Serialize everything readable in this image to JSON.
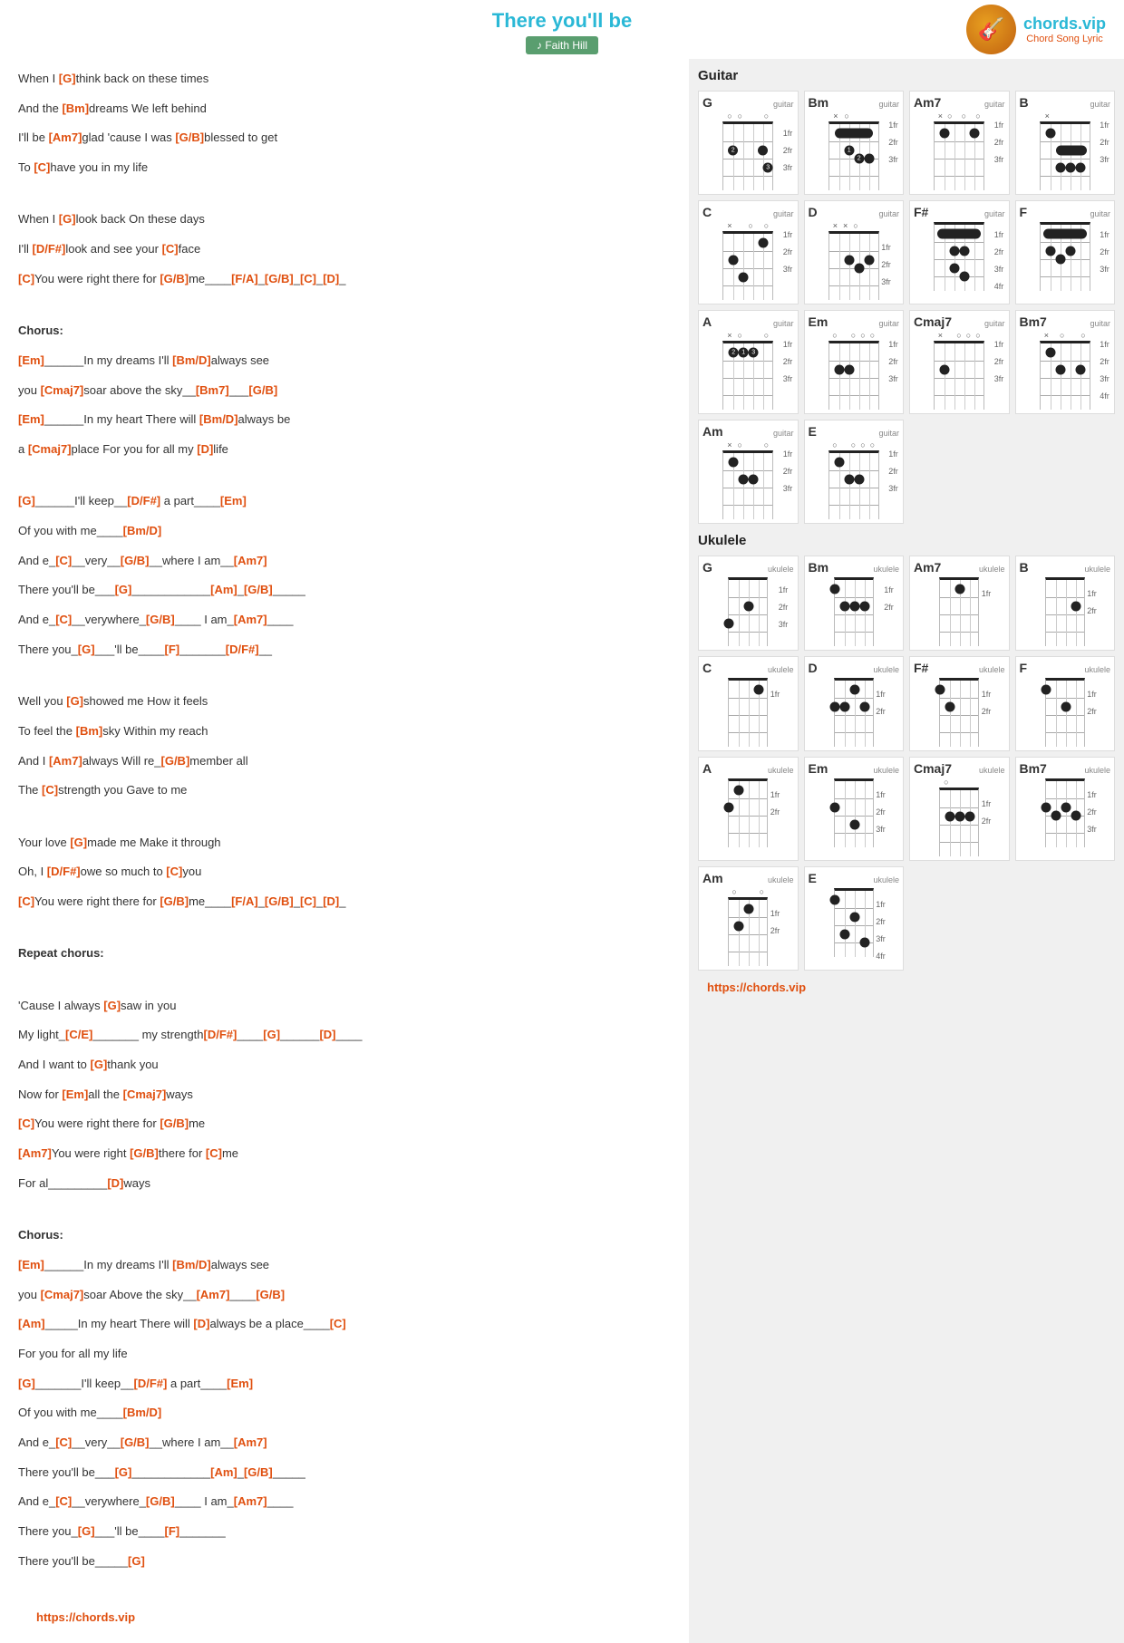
{
  "header": {
    "title": "There you'll be",
    "artist": "Faith Hill",
    "logo": {
      "brand": "chords.vip",
      "sub": "Chord Song Lyric",
      "icon": "🎸"
    }
  },
  "lyrics": [
    {
      "id": "v1l1",
      "text": "When I [G]think back on these times"
    },
    {
      "id": "v1l2",
      "text": "And the [Bm]dreams We left behind"
    },
    {
      "id": "v1l3",
      "text": "I'll be [Am7]glad 'cause I was [G/B]blessed to get"
    },
    {
      "id": "v1l4",
      "text": "To [C]have you in my life"
    },
    {
      "id": "v2l1",
      "text": "When I [G]look back On these days"
    },
    {
      "id": "v2l2",
      "text": "I'll [D/F#]look and see your [C]face"
    },
    {
      "id": "v2l3",
      "text": "[C]You were right there for [G/B]me____[F/A]_[G/B]_[C]_[D]_"
    },
    {
      "id": "ch1",
      "text": "Chorus:"
    },
    {
      "id": "c1l1",
      "text": "[Em]______In my dreams I'll [Bm/D]always see"
    },
    {
      "id": "c1l2",
      "text": "you [Cmaj7]soar above the sky__[Bm7]___[G/B]"
    },
    {
      "id": "c1l3",
      "text": "[Em]______In my heart There will [Bm/D]always be"
    },
    {
      "id": "c1l4",
      "text": "a [Cmaj7]place For you for all my [D]life"
    },
    {
      "id": "br1l1",
      "text": "[G]______I'll keep__[D/F#] a part____[Em]"
    },
    {
      "id": "br1l2",
      "text": "Of you with me____[Bm/D]"
    },
    {
      "id": "br1l3",
      "text": "And e_[C]__very__[G/B]__where I am__[Am7]"
    },
    {
      "id": "br1l4",
      "text": "There you'll be___[G]____________[Am]_[G/B]_____"
    },
    {
      "id": "br1l5",
      "text": "And e_[C]__verywhere_[G/B]____ I am_[Am7]____"
    },
    {
      "id": "br1l6",
      "text": "There you_[G]___'ll be____[F]_______[D/F#]__"
    },
    {
      "id": "v3l1",
      "text": "Well you [G]showed me How it feels"
    },
    {
      "id": "v3l2",
      "text": "To feel the [Bm]sky Within my reach"
    },
    {
      "id": "v3l3",
      "text": "And I [Am7]always Will re_[G/B]member all"
    },
    {
      "id": "v3l4",
      "text": "The [C]strength you Gave to me"
    },
    {
      "id": "v4l1",
      "text": "Your love [G]made me Make it through"
    },
    {
      "id": "v4l2",
      "text": "Oh, I [D/F#]owe so much to [C]you"
    },
    {
      "id": "v4l3",
      "text": "[C]You were right there for [G/B]me____[F/A]_[G/B]_[C]_[D]_"
    },
    {
      "id": "rep",
      "text": "Repeat chorus:"
    },
    {
      "id": "br2l1",
      "text": "'Cause I always [G]saw in you"
    },
    {
      "id": "br2l2",
      "text": "My light_[C/E]_______ my strength[D/F#]____[G]______[D]____"
    },
    {
      "id": "br2l3",
      "text": "And I want to [G]thank you"
    },
    {
      "id": "br2l4",
      "text": "Now for [Em]all the [Cmaj7]ways"
    },
    {
      "id": "br2l5",
      "text": "[C]You were right there for [G/B]me"
    },
    {
      "id": "br2l6",
      "text": "[Am7]You were right [G/B]there for [C]me"
    },
    {
      "id": "br2l7",
      "text": "For al_________[D]ways"
    },
    {
      "id": "ch2",
      "text": "Chorus:"
    },
    {
      "id": "c2l1",
      "text": "[Em]______In my dreams I'll [Bm/D]always see"
    },
    {
      "id": "c2l2",
      "text": "you [Cmaj7]soar Above the sky__[Am7]____[G/B]"
    },
    {
      "id": "c2l3",
      "text": "[Am]_____In my heart There will [D]always be a place____[C]"
    },
    {
      "id": "c2l4",
      "text": "For you for all my life"
    },
    {
      "id": "c2l5",
      "text": "[G]_______I'll keep__[D/F#] a part____[Em]"
    },
    {
      "id": "c2l6",
      "text": "Of you with me____[Bm/D]"
    },
    {
      "id": "c2l7",
      "text": "And e_[C]__very__[G/B]__where I am__[Am7]"
    },
    {
      "id": "c2l8",
      "text": "There you'll be___[G]____________[Am]_[G/B]_____"
    },
    {
      "id": "c2l9",
      "text": "And e_[C]__verywhere_[G/B]____ I am_[Am7]____"
    },
    {
      "id": "c2l10",
      "text": "There you_[G]___'ll be____[F]_______"
    },
    {
      "id": "c2l11",
      "text": "There you'll be_____[G]"
    }
  ],
  "footer_url": "https://chords.vip",
  "chords_section": {
    "guitar_label": "Guitar",
    "ukulele_label": "Ukulele",
    "footer_url": "https://chords.vip"
  }
}
